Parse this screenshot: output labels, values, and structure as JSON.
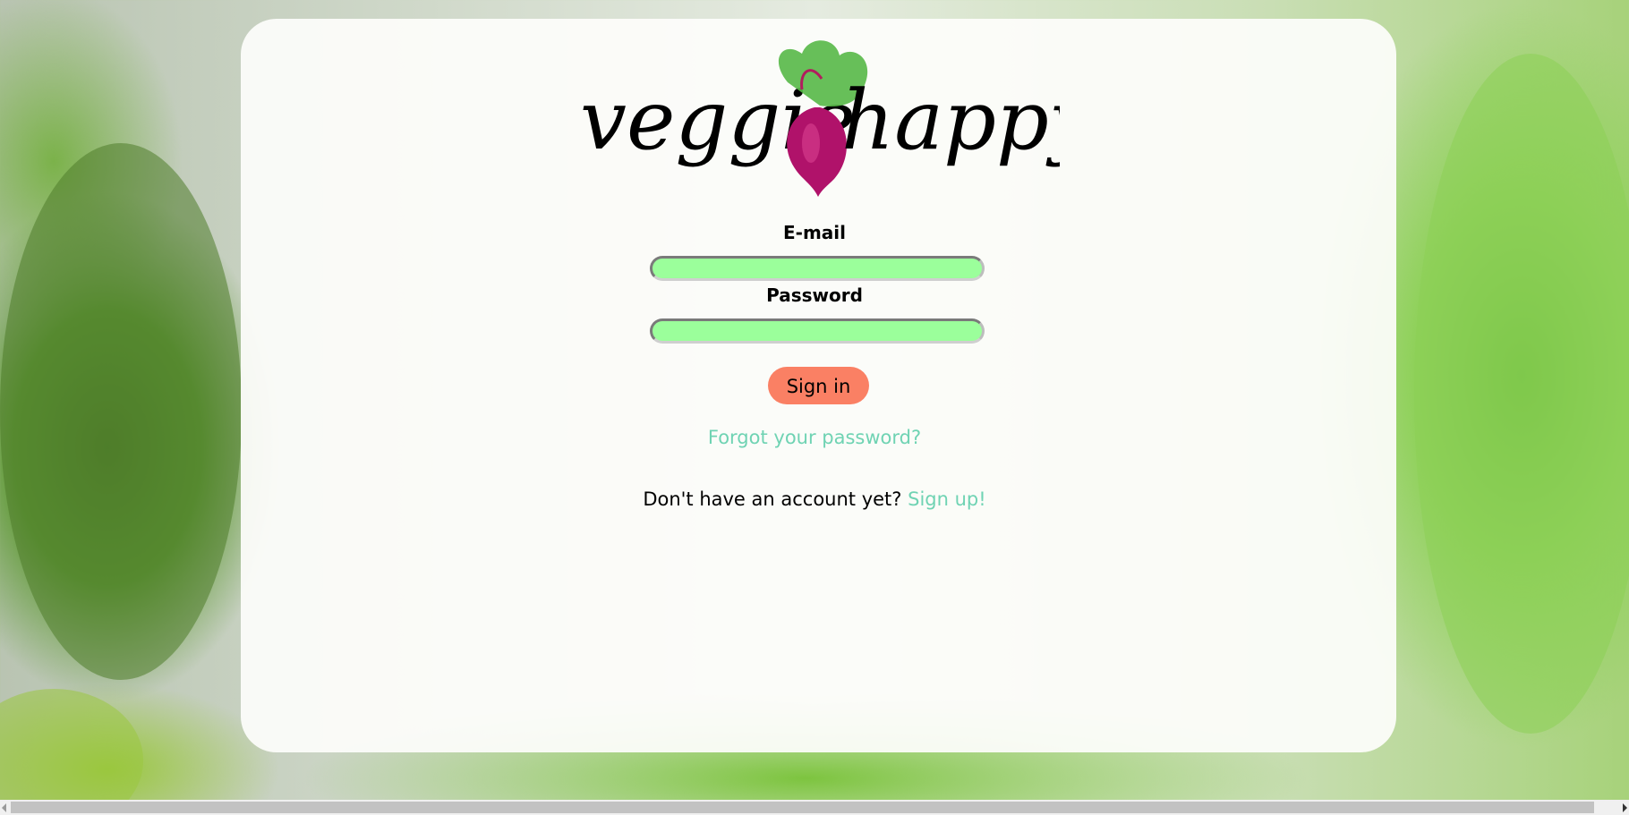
{
  "logo": {
    "word_left": "veggie",
    "word_right": "happy",
    "icon": "beet-icon"
  },
  "form": {
    "email_label": "E-mail",
    "email_value": "",
    "password_label": "Password",
    "password_value": "",
    "signin_label": "Sign in"
  },
  "links": {
    "forgot_password": "Forgot your password?",
    "no_account_text": "Don't have an account yet?",
    "signup": "Sign up!"
  },
  "colors": {
    "field_bg": "#9bff9b",
    "signin_bg": "#fa8064",
    "link": "#6fd3b3"
  }
}
